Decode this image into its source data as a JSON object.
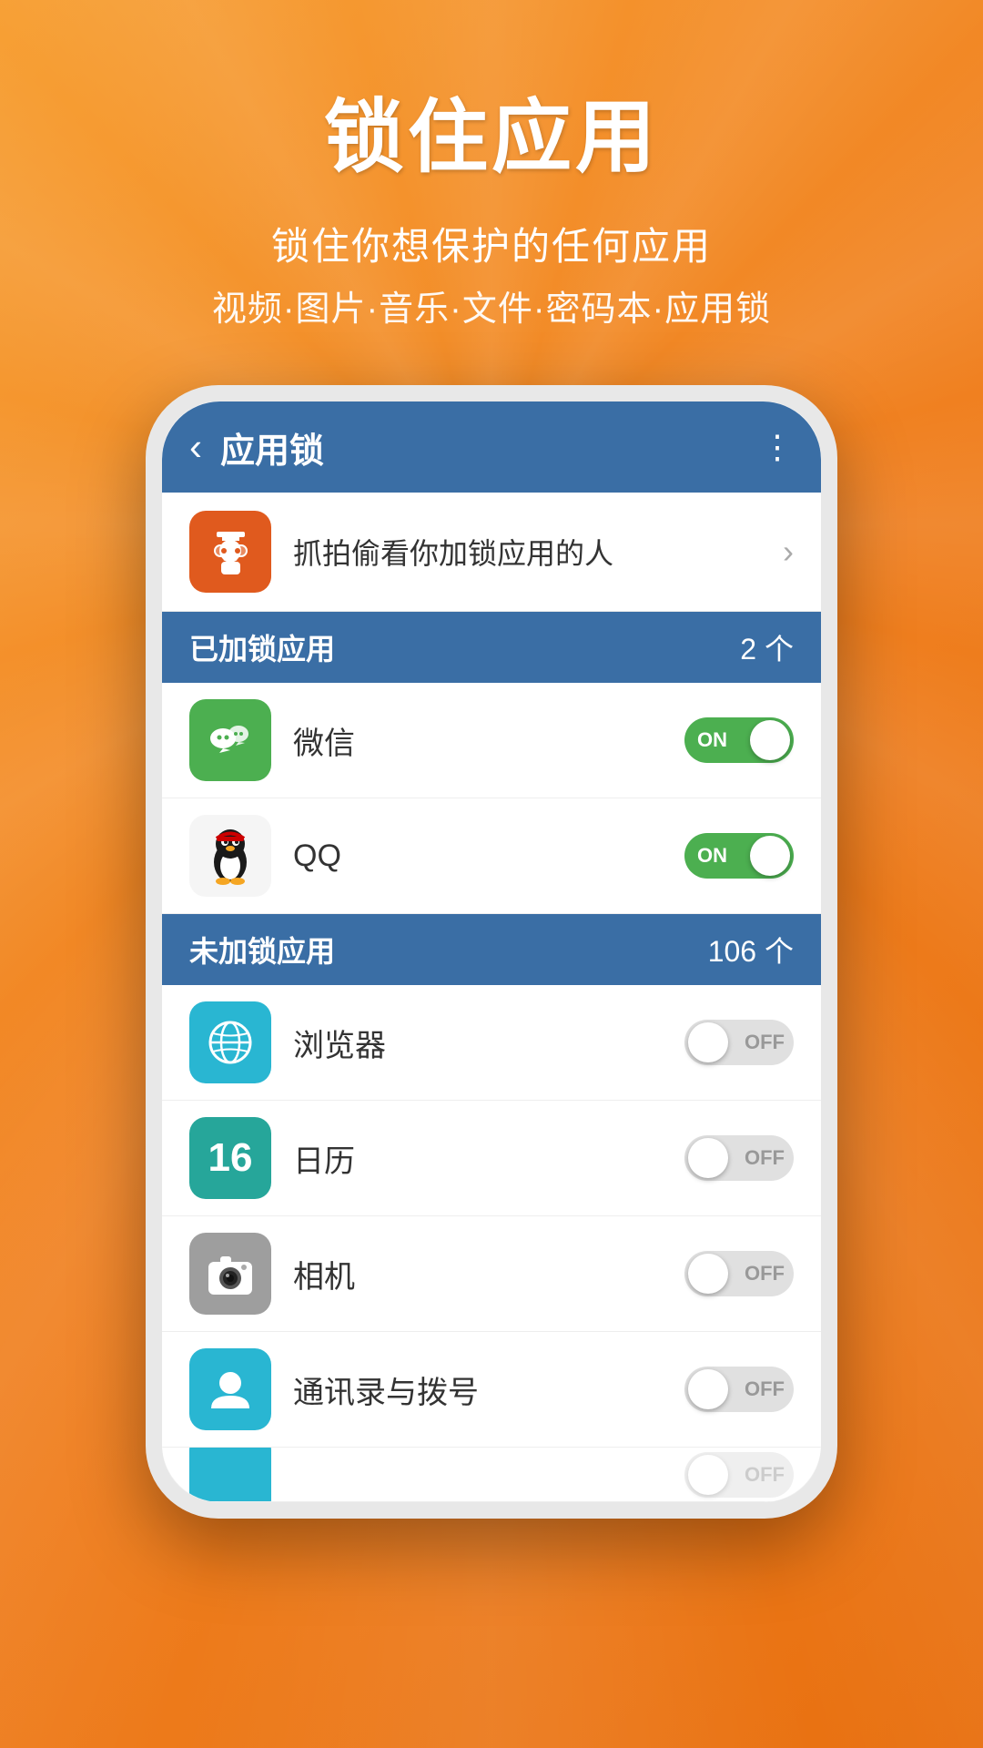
{
  "background": {
    "gradient_from": "#f7a035",
    "gradient_to": "#e87010"
  },
  "header": {
    "title": "锁住应用",
    "subtitle1": "锁住你想保护的任何应用",
    "subtitle2": "视频·图片·音乐·文件·密码本·应用锁"
  },
  "app_bar": {
    "back_icon": "‹",
    "title": "应用锁",
    "menu_icon": "⋮"
  },
  "spy_row": {
    "icon": "🕵",
    "text": "抓拍偷看你加锁应用的人",
    "chevron": "›"
  },
  "locked_section": {
    "label": "已加锁应用",
    "count": "2 个"
  },
  "locked_apps": [
    {
      "name": "微信",
      "icon_type": "wechat",
      "toggle_state": "ON"
    },
    {
      "name": "QQ",
      "icon_type": "qq",
      "toggle_state": "ON"
    }
  ],
  "unlocked_section": {
    "label": "未加锁应用",
    "count": "106 个"
  },
  "unlocked_apps": [
    {
      "name": "浏览器",
      "icon_type": "browser",
      "toggle_state": "OFF"
    },
    {
      "name": "日历",
      "icon_type": "calendar",
      "toggle_state": "OFF",
      "icon_number": "16"
    },
    {
      "name": "相机",
      "icon_type": "camera",
      "toggle_state": "OFF"
    },
    {
      "name": "通讯录与拨号",
      "icon_type": "contacts",
      "toggle_state": "OFF"
    }
  ],
  "partial_row": {
    "toggle_state": "OFF"
  }
}
